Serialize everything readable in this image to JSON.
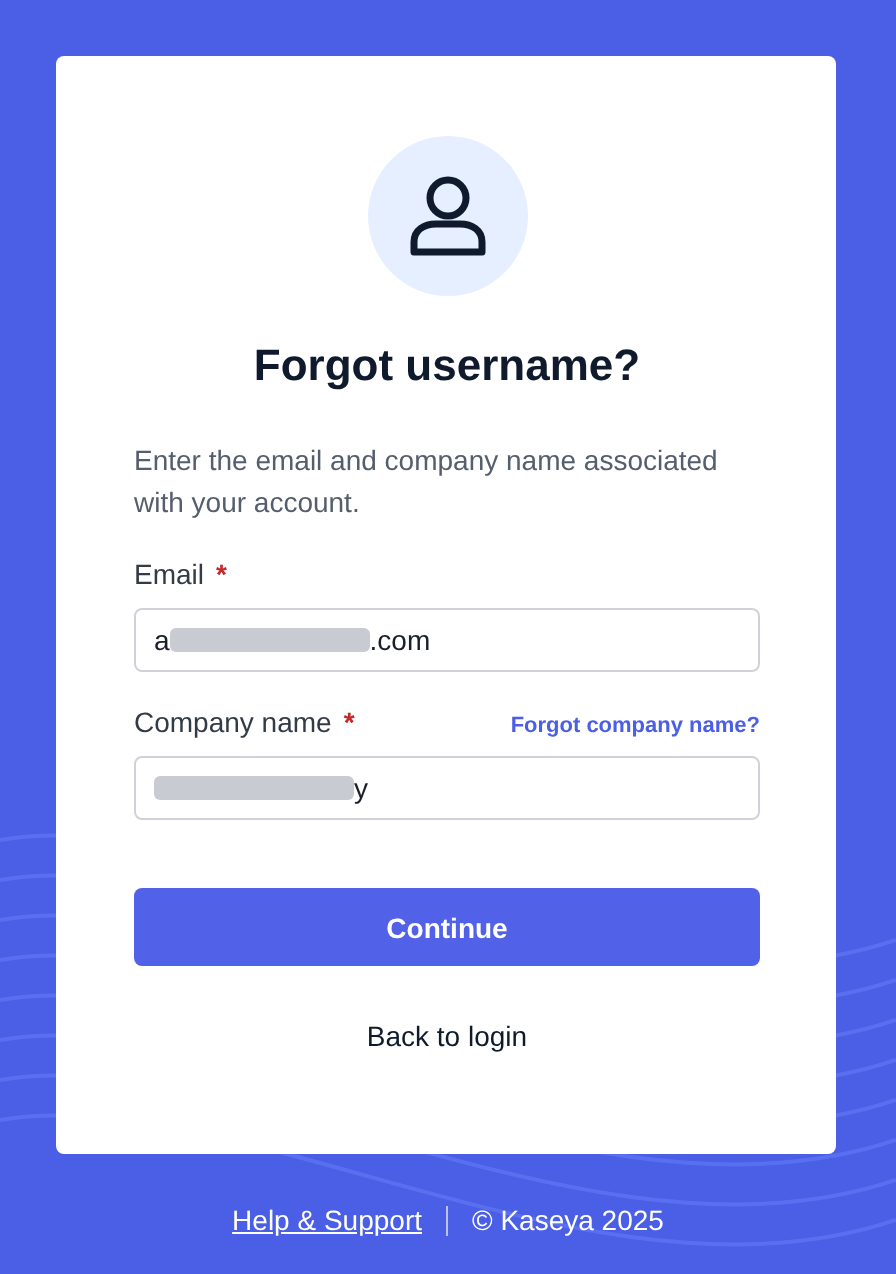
{
  "heading": "Forgot username?",
  "description": "Enter the email and company name associated with your account.",
  "fields": [
    {
      "label": "Email",
      "required_mark": "*",
      "value_start": "a",
      "value_end": ".com"
    },
    {
      "label": "Company name",
      "required_mark": "*",
      "link": "Forgot company name?",
      "value_end": "y"
    }
  ],
  "submit_button": "Continue",
  "back_link": "Back to login",
  "footer": {
    "link": "Help & Support",
    "copyright": "© Kaseya 2025"
  }
}
